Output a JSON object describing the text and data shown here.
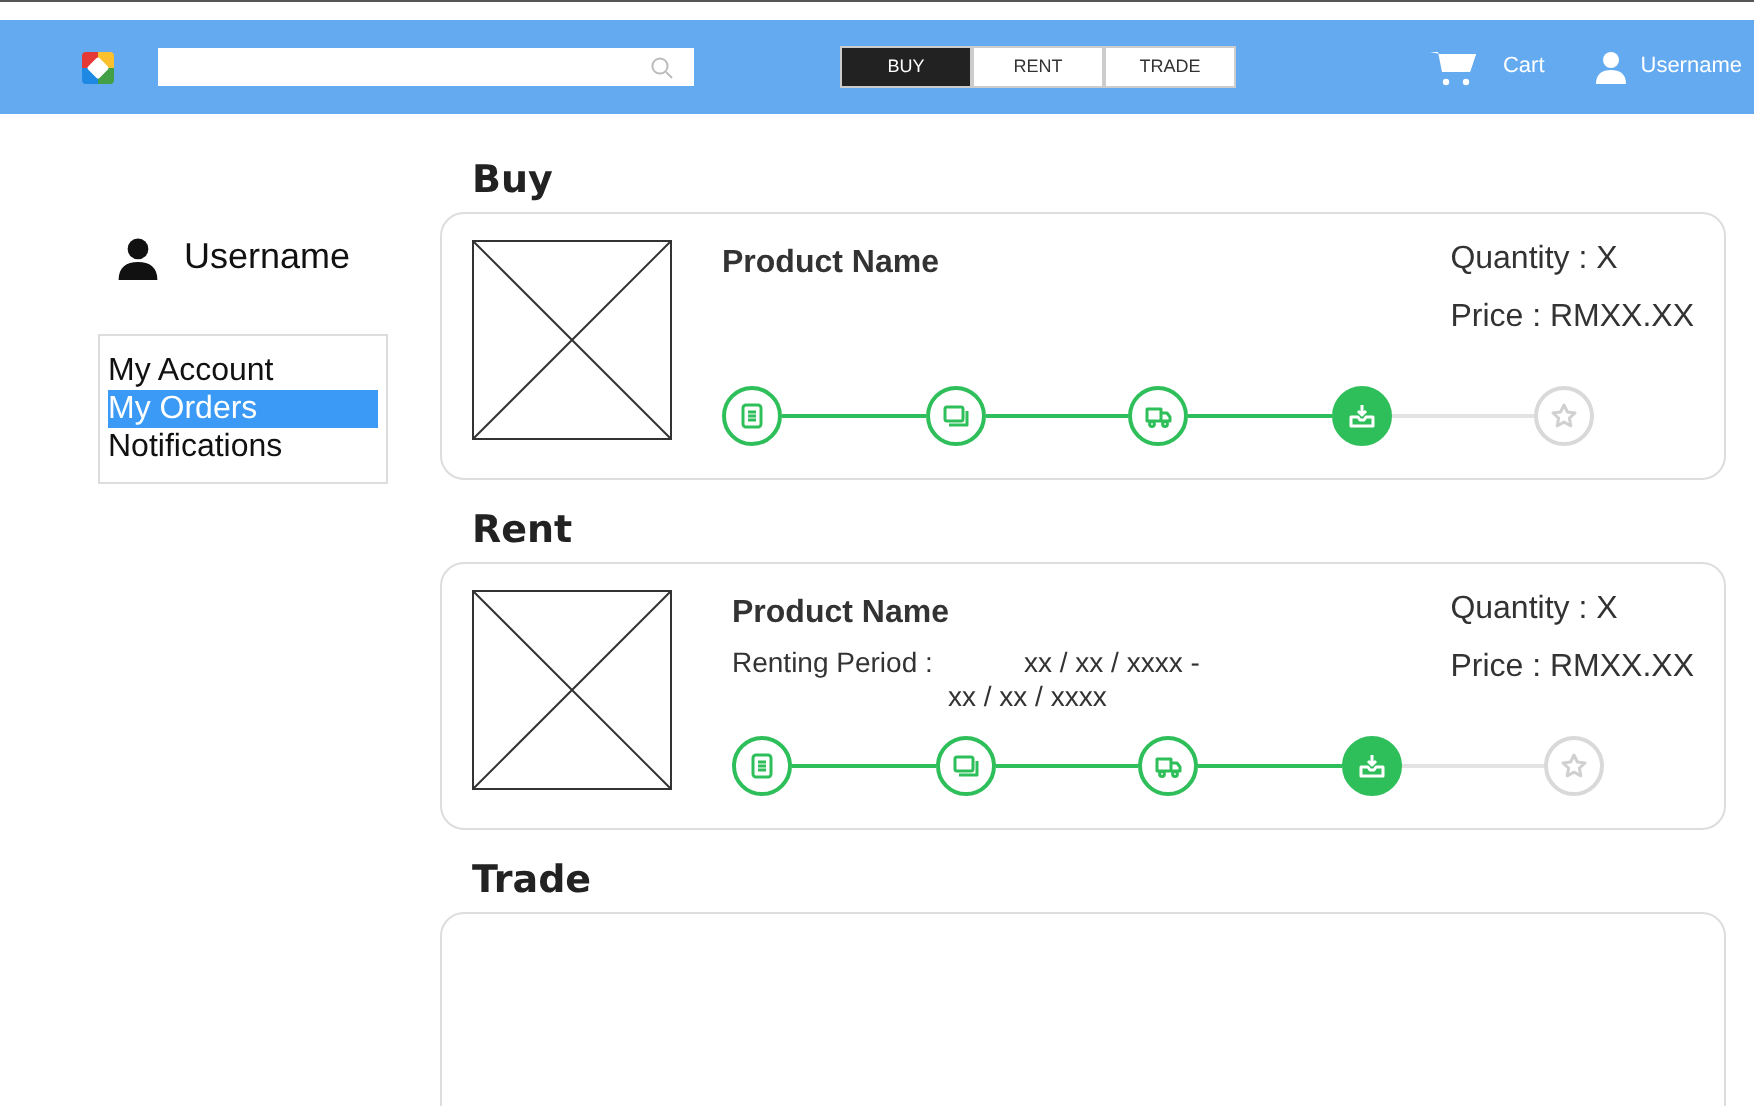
{
  "header": {
    "tabs": [
      {
        "label": "BUY",
        "selected": true
      },
      {
        "label": "RENT",
        "selected": false
      },
      {
        "label": "TRADE",
        "selected": false
      }
    ],
    "cart": "Cart",
    "user": "Username"
  },
  "sidebar": {
    "user": "Username",
    "items": [
      {
        "label": "My Account",
        "selected": false
      },
      {
        "label": "My Orders",
        "selected": true
      },
      {
        "label": "Notifications",
        "selected": false
      }
    ]
  },
  "sections": [
    {
      "title": "Buy",
      "order": {
        "product": "Product Name",
        "quantity": "Quantity : X",
        "price": "Price : RMXX.XX",
        "steps": [
          {
            "done": true,
            "current": false
          },
          {
            "done": true,
            "current": false
          },
          {
            "done": true,
            "current": false
          },
          {
            "done": true,
            "current": true
          },
          {
            "done": false,
            "current": false
          }
        ]
      }
    },
    {
      "title": "Rent",
      "order": {
        "product": "Product Name",
        "period_label": "Renting Period :",
        "period_start": "xx / xx / xxxx -",
        "period_end": "xx / xx / xxxx",
        "quantity": "Quantity : X",
        "price": "Price : RMXX.XX",
        "steps": [
          {
            "done": true,
            "current": false
          },
          {
            "done": true,
            "current": false
          },
          {
            "done": true,
            "current": false
          },
          {
            "done": true,
            "current": true
          },
          {
            "done": false,
            "current": false
          }
        ]
      }
    },
    {
      "title": "Trade"
    }
  ]
}
